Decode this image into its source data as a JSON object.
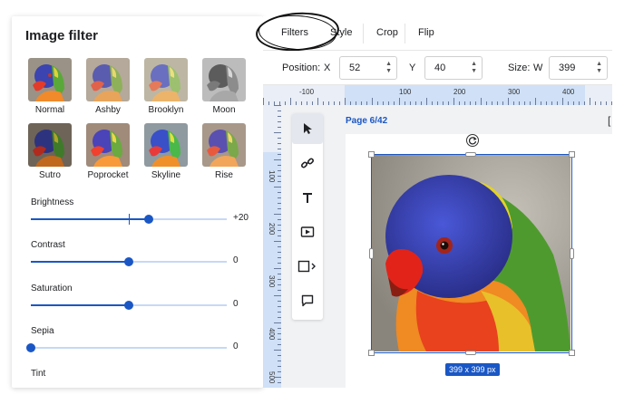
{
  "panel": {
    "title": "Image filter",
    "filters": [
      {
        "name": "Normal"
      },
      {
        "name": "Ashby"
      },
      {
        "name": "Brooklyn"
      },
      {
        "name": "Moon"
      },
      {
        "name": "Sutro"
      },
      {
        "name": "Poprocket"
      },
      {
        "name": "Skyline"
      },
      {
        "name": "Rise"
      }
    ],
    "sliders": [
      {
        "label": "Brightness",
        "value": "+20",
        "fraction": 0.6,
        "mark": 0.5
      },
      {
        "label": "Contrast",
        "value": "0",
        "fraction": 0.5
      },
      {
        "label": "Saturation",
        "value": "0",
        "fraction": 0.5
      },
      {
        "label": "Sepia",
        "value": "0",
        "fraction": 0.0
      },
      {
        "label": "Tint",
        "value": ""
      }
    ]
  },
  "tabs": {
    "filters": "Filters",
    "style": "Style",
    "crop": "Crop",
    "flip": "Flip"
  },
  "props": {
    "position_label": "Position:",
    "x_label": "X",
    "x_value": "52",
    "y_label": "Y",
    "y_value": "40",
    "size_label": "Size:",
    "w_label": "W",
    "w_value": "399"
  },
  "ruler": {
    "h": [
      "-100",
      "100",
      "200",
      "300",
      "400"
    ],
    "v": [
      "100",
      "200",
      "300",
      "400",
      "500"
    ]
  },
  "canvas": {
    "page_label": "Page 6/42",
    "size_badge": "399 x 399 px"
  },
  "colors": {
    "accent": "#1a57c5",
    "accent_light": "#c6d8f5"
  }
}
